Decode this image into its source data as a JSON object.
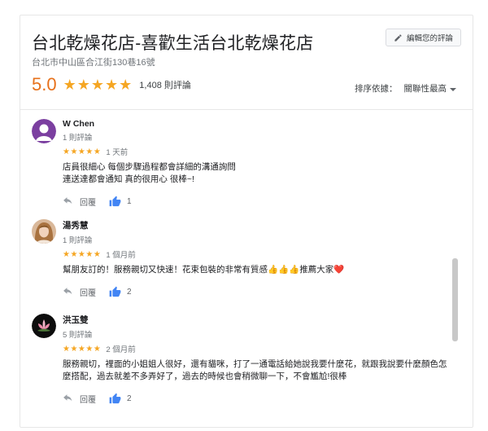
{
  "header": {
    "title": "台北乾燥花店-喜歡生活台北乾燥花店",
    "address": "台北市中山區合江街130巷16號",
    "edit_button_label": "編輯您的評論"
  },
  "summary": {
    "rating": "5.0",
    "stars": "★★★★★",
    "review_count": "1,408 則評論"
  },
  "sort": {
    "label": "排序依據：",
    "value": "關聯性最高"
  },
  "reviews": [
    {
      "name": "W Chen",
      "count": "1 則評論",
      "stars": "★★★★★",
      "time": "1 天前",
      "text": "店員很細心 每個步驟過程都會詳細的溝通詢問\n連送達都會通知 真的很用心 很棒~!",
      "reply_label": "回覆",
      "likes": "1"
    },
    {
      "name": "湯秀慧",
      "count": "1 則評論",
      "stars": "★★★★★",
      "time": "1 個月前",
      "text": "幫朋友訂的！服務親切又快速！花束包裝的非常有質感👍👍👍推薦大家❤️",
      "reply_label": "回覆",
      "likes": "2"
    },
    {
      "name": "洪玉雙",
      "count": "5 則評論",
      "stars": "★★★★★",
      "time": "2 個月前",
      "text": "服務親切，裡面的小姐姐人很好，還有貓咪，打了一通電話給她說我要什麼花，就跟我說要什麼顏色怎麼搭配，過去就差不多弄好了，過去的時候也會稍微聊一下，不會尷尬!很棒",
      "reply_label": "回覆",
      "likes": "2"
    }
  ],
  "colors": {
    "star": "#f5a623",
    "rating": "#e7711b",
    "like": "#4285f4"
  }
}
